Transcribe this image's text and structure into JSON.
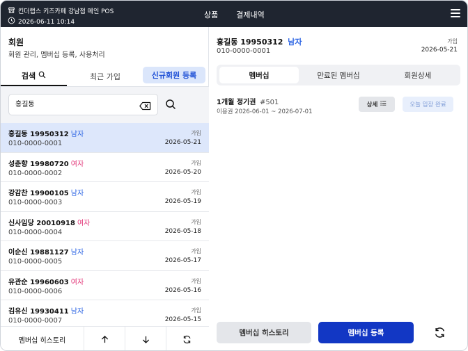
{
  "topbar": {
    "store_name": "킨더랩스 키즈카페 강남점 메인 POS",
    "datetime": "2026-06-11 10:14",
    "nav": [
      "상품",
      "결제내역"
    ],
    "icons": {
      "store": "store-icon",
      "clock": "clock-icon",
      "menu": "hamburger-menu-icon"
    }
  },
  "left": {
    "title": "회원",
    "subtitle": "회원 관리, 멤버십 등록, 사용처리",
    "tabs": {
      "search": "검색",
      "recent": "최근 가입",
      "new_member": "신규회원 등록"
    },
    "search": {
      "value": "홍길동",
      "placeholder": ""
    },
    "members": [
      {
        "name": "홍길동",
        "birth": "19950312",
        "gender": "남자",
        "phone": "010-0000-0001",
        "joined_label": "가입",
        "joined": "2026-05-21",
        "selected": true
      },
      {
        "name": "성춘향",
        "birth": "19980720",
        "gender": "여자",
        "phone": "010-0000-0002",
        "joined_label": "가입",
        "joined": "2026-05-20",
        "selected": false
      },
      {
        "name": "강감찬",
        "birth": "19900105",
        "gender": "남자",
        "phone": "010-0000-0003",
        "joined_label": "가입",
        "joined": "2026-05-19",
        "selected": false
      },
      {
        "name": "신사임당",
        "birth": "20010918",
        "gender": "여자",
        "phone": "010-0000-0004",
        "joined_label": "가입",
        "joined": "2026-05-18",
        "selected": false
      },
      {
        "name": "이순신",
        "birth": "19881127",
        "gender": "남자",
        "phone": "010-0000-0005",
        "joined_label": "가입",
        "joined": "2026-05-17",
        "selected": false
      },
      {
        "name": "유관순",
        "birth": "19960603",
        "gender": "여자",
        "phone": "010-0000-0006",
        "joined_label": "가입",
        "joined": "2026-05-16",
        "selected": false
      },
      {
        "name": "김유신",
        "birth": "19930411",
        "gender": "남자",
        "phone": "010-0000-0007",
        "joined_label": "가입",
        "joined": "2026-05-15",
        "selected": false
      }
    ],
    "bottom": {
      "history": "멤버십 히스토리"
    }
  },
  "right": {
    "member": {
      "name": "홍길동",
      "birth": "19950312",
      "gender": "남자",
      "phone": "010-0000-0001",
      "joined_label": "가입",
      "joined": "2026-05-21"
    },
    "tabs": [
      "멤버십",
      "만료된 멤버십",
      "회원상세"
    ],
    "membership": {
      "title": "1개월 정기권",
      "number": "#501",
      "period": "이용권 2026-06-01 ~ 2026-07-01",
      "detail_label": "상세",
      "entry_status": "오늘 입장 완료"
    },
    "buttons": {
      "history": "멤버십 히스토리",
      "register": "멤버십 등록"
    }
  },
  "colors": {
    "topbar": "#1f2530",
    "male": "#2a63e3",
    "female": "#e2387a",
    "selected_row": "#dde7fb",
    "primary": "#1237c4"
  }
}
